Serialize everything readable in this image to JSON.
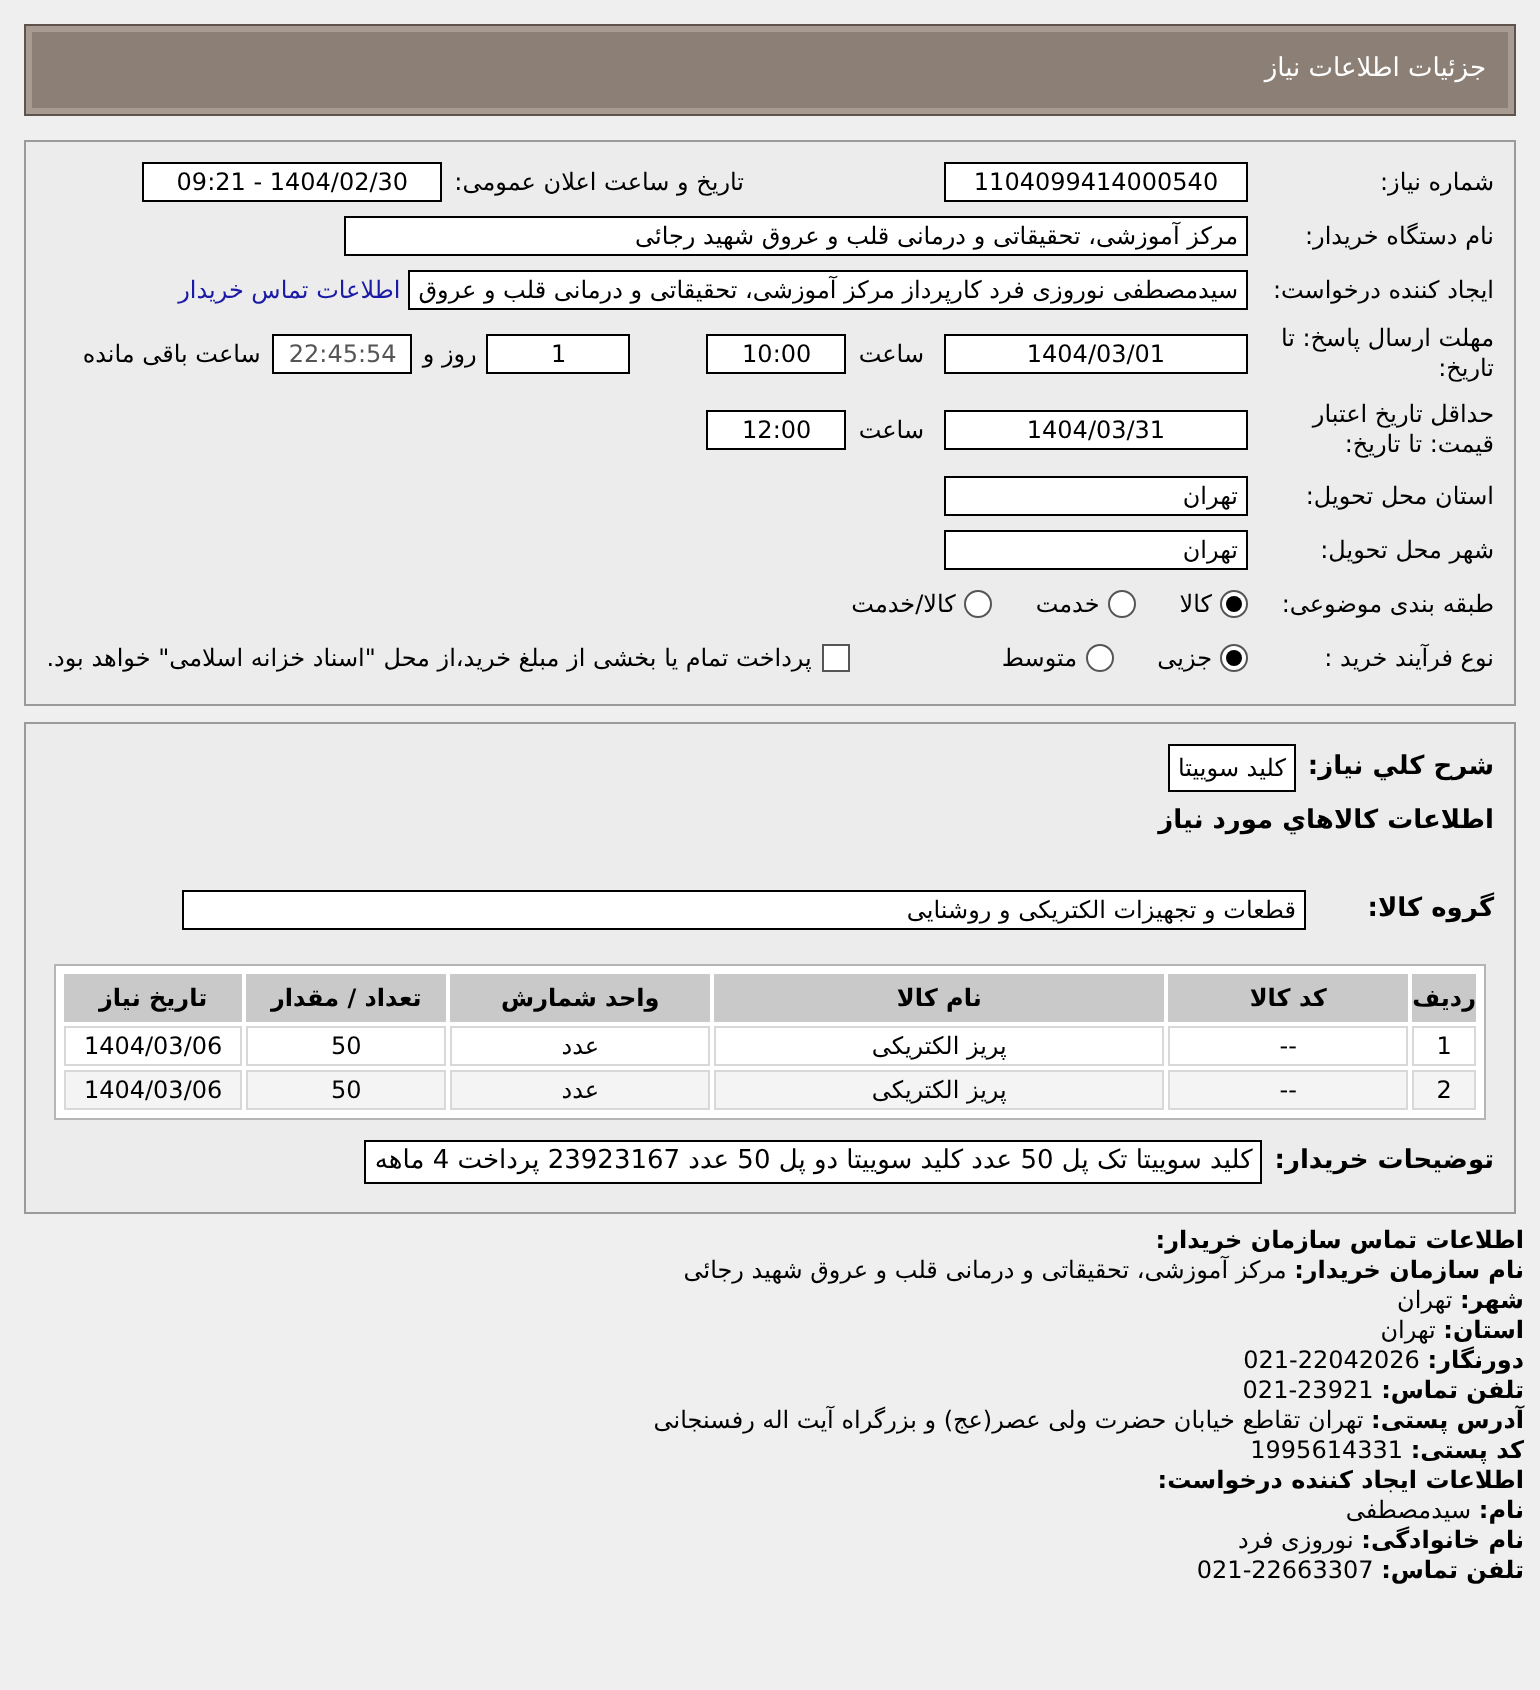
{
  "header": {
    "title": "جزئیات اطلاعات نیاز"
  },
  "details": {
    "need_number": {
      "label": "شماره نیاز:",
      "value": "1104099414000540"
    },
    "announce": {
      "label": "تاریخ و ساعت اعلان عمومی:",
      "value": "1404/02/30 - 09:21"
    },
    "buyer_org": {
      "label": "نام دستگاه خریدار:",
      "value": "مرکز آموزشی، تحقیقاتی و درمانی قلب و عروق شهید رجائی"
    },
    "creator": {
      "label": "ایجاد کننده درخواست:",
      "value": "سیدمصطفی نوروزی فرد کارپرداز مرکز آموزشی، تحقیقاتی و درمانی قلب و عروق",
      "link": "اطلاعات تماس خریدار"
    },
    "deadline": {
      "label": "مهلت ارسال پاسخ: تا تاریخ:",
      "date": "1404/03/01",
      "time_label": "ساعت",
      "time": "10:00",
      "days": "1",
      "days_label": "روز و",
      "remaining": "22:45:54",
      "remaining_label": "ساعت باقی مانده"
    },
    "validity": {
      "label": "حداقل تاریخ اعتبار قیمت: تا تاریخ:",
      "date": "1404/03/31",
      "time_label": "ساعت",
      "time": "12:00"
    },
    "province": {
      "label": "استان محل تحویل:",
      "value": "تهران"
    },
    "city": {
      "label": "شهر محل تحویل:",
      "value": "تهران"
    },
    "category": {
      "label": "طبقه بندی موضوعی:",
      "options": [
        {
          "label": "کالا",
          "selected": true
        },
        {
          "label": "خدمت",
          "selected": false
        },
        {
          "label": "کالا/خدمت",
          "selected": false
        }
      ]
    },
    "process": {
      "label": "نوع فرآیند خرید :",
      "options": [
        {
          "label": "جزیی",
          "selected": true
        },
        {
          "label": "متوسط",
          "selected": false
        }
      ],
      "treasury": {
        "checked": false,
        "label": "پرداخت تمام یا بخشی از مبلغ خرید،از محل \"اسناد خزانه اسلامی\" خواهد بود."
      }
    }
  },
  "need": {
    "summary": {
      "label": "شرح کلي نياز:",
      "value": "کلید سوییتا"
    },
    "goods_heading": "اطلاعات کالاهاي مورد نياز",
    "group": {
      "label": "گروه کالا:",
      "value": "قطعات و تجهیزات الکتریکی و روشنایی"
    },
    "table": {
      "columns": [
        "ردیف",
        "کد کالا",
        "نام کالا",
        "واحد شمارش",
        "تعداد / مقدار",
        "تاریخ نیاز"
      ],
      "rows": [
        [
          "1",
          "--",
          "پریز الکتریکی",
          "عدد",
          "50",
          "1404/03/06"
        ],
        [
          "2",
          "--",
          "پریز الکتریکی",
          "عدد",
          "50",
          "1404/03/06"
        ]
      ]
    },
    "buyer_notes": {
      "label": "توضیحات خریدار:",
      "value": "کلید سوییتا تک پل 50 عدد کلید سوییتا دو پل 50 عدد 23923167 پرداخت 4 ماهه"
    }
  },
  "contact": {
    "lines": [
      {
        "kind": "heading",
        "text": "اطلاعات تماس سازمان خریدار:"
      },
      {
        "kind": "line",
        "text": "**نام سازمان خریدار:** مرکز آموزشی، تحقیقاتی و درمانی قلب و عروق شهید رجائی"
      },
      {
        "kind": "line",
        "text": "**شهر:** تهران"
      },
      {
        "kind": "line",
        "text": "**استان:** تهران"
      },
      {
        "kind": "line",
        "text": "**دورنگار:** 22042026-021"
      },
      {
        "kind": "line",
        "text": "**تلفن تماس:** 23921-021"
      },
      {
        "kind": "line",
        "text": "**آدرس پستی:** تهران تقاطع خیابان حضرت ولی عصر(عج) و بزرگراه آیت اله رفسنجانی"
      },
      {
        "kind": "line",
        "text": "**کد پستی:** 1995614331"
      },
      {
        "kind": "heading",
        "text": "اطلاعات ایجاد کننده درخواست:"
      },
      {
        "kind": "line",
        "text": "**نام:** سیدمصطفی"
      },
      {
        "kind": "line",
        "text": "**نام خانوادگی:** نوروزی فرد"
      },
      {
        "kind": "line",
        "text": "**تلفن تماس:** 22663307-021"
      }
    ]
  }
}
